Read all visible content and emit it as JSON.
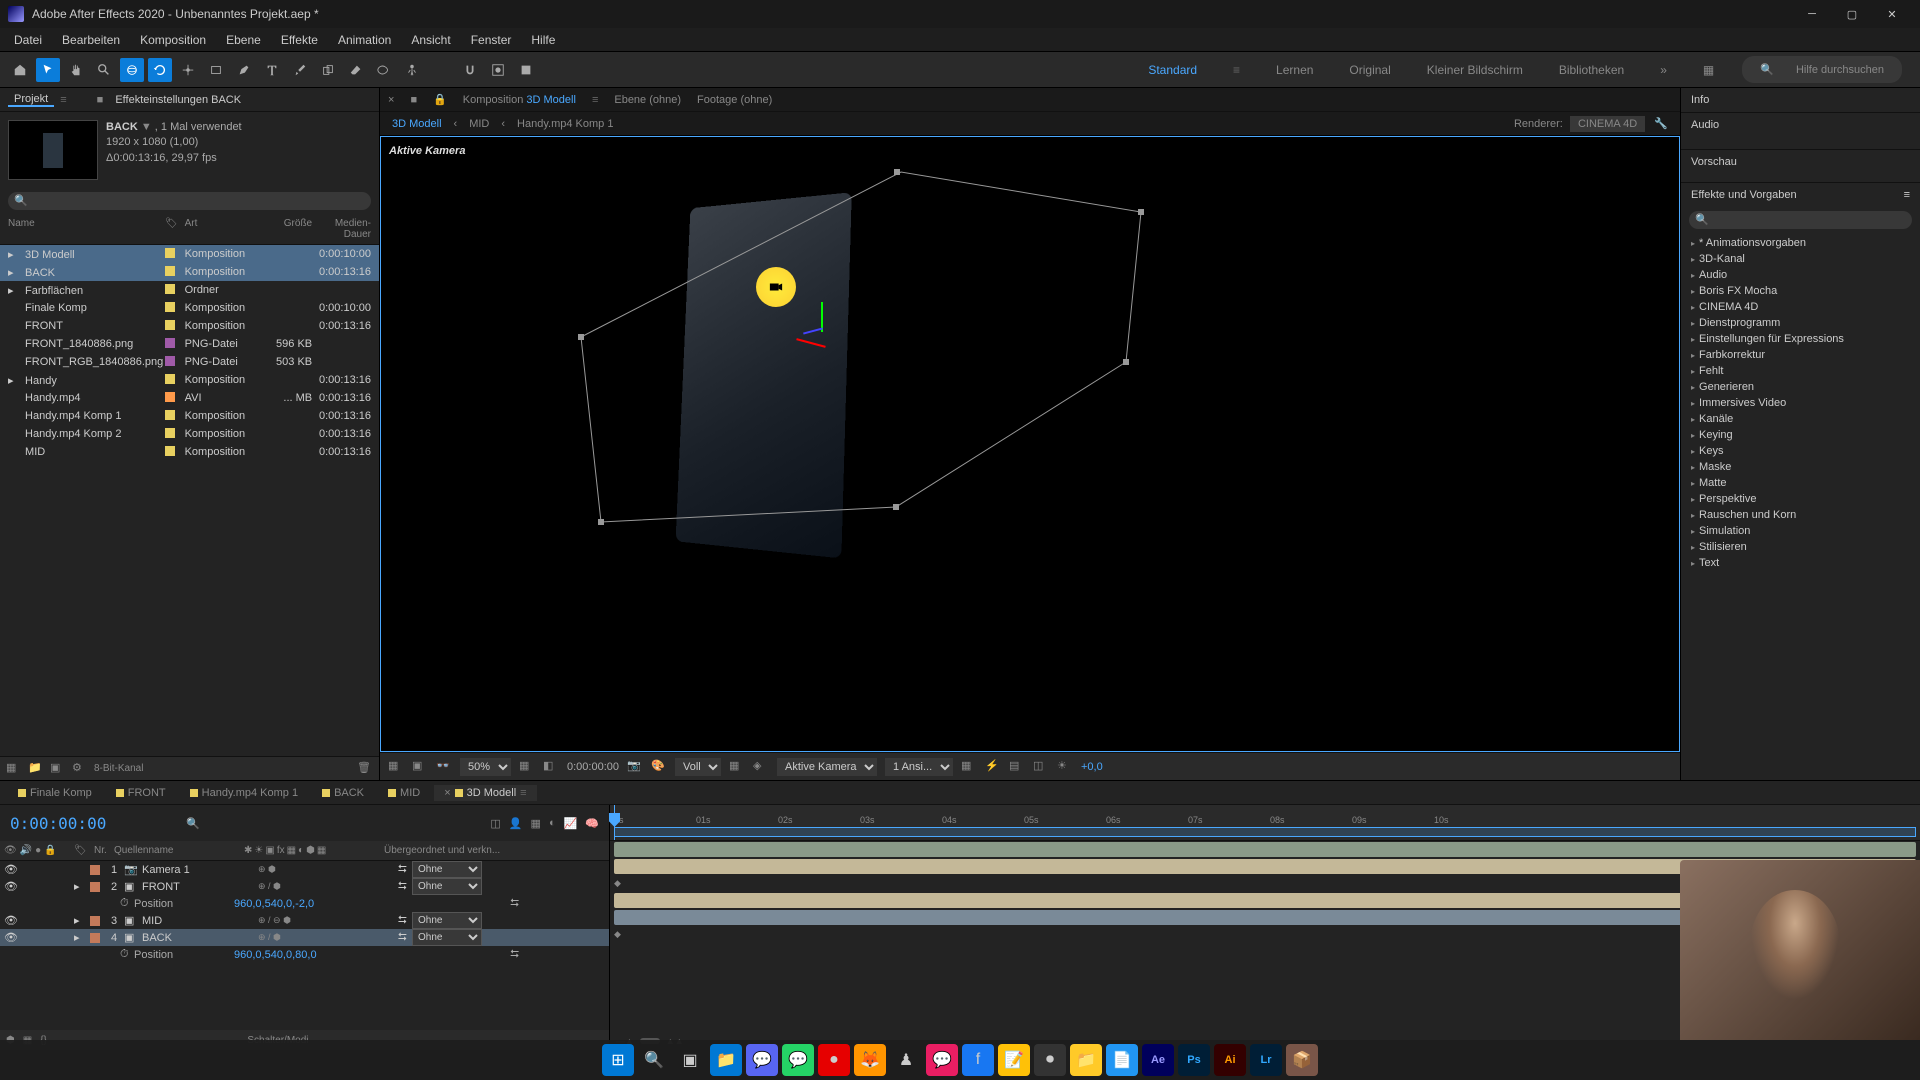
{
  "titlebar": {
    "title": "Adobe After Effects 2020 - Unbenanntes Projekt.aep *"
  },
  "menu": [
    "Datei",
    "Bearbeiten",
    "Komposition",
    "Ebene",
    "Effekte",
    "Animation",
    "Ansicht",
    "Fenster",
    "Hilfe"
  ],
  "workspaces": {
    "items": [
      "Standard",
      "Lernen",
      "Original",
      "Kleiner Bildschirm",
      "Bibliotheken"
    ],
    "active": "Standard"
  },
  "help_search_placeholder": "Hilfe durchsuchen",
  "project": {
    "tab1": "Projekt",
    "tab2": "Effekteinstellungen BACK",
    "selected_name": "BACK",
    "usage": "1 Mal verwendet",
    "resolution": "1920 x 1080 (1,00)",
    "duration": "Δ0:00:13:16, 29,97 fps",
    "columns": {
      "name": "Name",
      "art": "Art",
      "size": "Größe",
      "dur": "Medien-Dauer"
    },
    "items": [
      {
        "name": "3D Modell",
        "icon": "▸",
        "color": "#e8d060",
        "art": "Komposition",
        "size": "",
        "dur": "0:00:10:00",
        "selected": true
      },
      {
        "name": "BACK",
        "icon": "▸",
        "color": "#e8d060",
        "art": "Komposition",
        "size": "",
        "dur": "0:00:13:16",
        "selected": true
      },
      {
        "name": "Farbflächen",
        "icon": "▸",
        "color": "#e8d060",
        "art": "Ordner",
        "size": "",
        "dur": ""
      },
      {
        "name": "Finale Komp",
        "icon": "",
        "color": "#e8d060",
        "art": "Komposition",
        "size": "",
        "dur": "0:00:10:00"
      },
      {
        "name": "FRONT",
        "icon": "",
        "color": "#e8d060",
        "art": "Komposition",
        "size": "",
        "dur": "0:00:13:16"
      },
      {
        "name": "FRONT_1840886.png",
        "icon": "",
        "color": "#a05aa8",
        "art": "PNG-Datei",
        "size": "596 KB",
        "dur": ""
      },
      {
        "name": "FRONT_RGB_1840886.png",
        "icon": "",
        "color": "#a05aa8",
        "art": "PNG-Datei",
        "size": "503 KB",
        "dur": ""
      },
      {
        "name": "Handy",
        "icon": "▸",
        "color": "#e8d060",
        "art": "Komposition",
        "size": "",
        "dur": "0:00:13:16"
      },
      {
        "name": "Handy.mp4",
        "icon": "",
        "color": "#ff9a4a",
        "art": "AVI",
        "size": "... MB",
        "dur": "0:00:13:16"
      },
      {
        "name": "Handy.mp4 Komp 1",
        "icon": "",
        "color": "#e8d060",
        "art": "Komposition",
        "size": "",
        "dur": "0:00:13:16"
      },
      {
        "name": "Handy.mp4 Komp 2",
        "icon": "",
        "color": "#e8d060",
        "art": "Komposition",
        "size": "",
        "dur": "0:00:13:16"
      },
      {
        "name": "MID",
        "icon": "",
        "color": "#e8d060",
        "art": "Komposition",
        "size": "",
        "dur": "0:00:13:16"
      }
    ],
    "footer_depth": "8-Bit-Kanal"
  },
  "comp": {
    "tabs": {
      "komp": "Komposition",
      "komp_name": "3D Modell",
      "ebene": "Ebene (ohne)",
      "footage": "Footage (ohne)"
    },
    "breadcrumb": [
      "3D Modell",
      "MID",
      "Handy.mp4 Komp 1"
    ],
    "renderer_label": "Renderer:",
    "renderer_value": "CINEMA 4D",
    "camera_label": "Aktive Kamera",
    "footer": {
      "zoom": "50%",
      "time": "0:00:00:00",
      "res": "Voll",
      "camera": "Aktive Kamera",
      "views": "1 Ansi...",
      "exposure": "+0,0"
    }
  },
  "right": {
    "info": "Info",
    "audio": "Audio",
    "vorschau": "Vorschau",
    "effects_title": "Effekte und Vorgaben",
    "categories": [
      "* Animationsvorgaben",
      "3D-Kanal",
      "Audio",
      "Boris FX Mocha",
      "CINEMA 4D",
      "Dienstprogramm",
      "Einstellungen für Expressions",
      "Farbkorrektur",
      "Fehlt",
      "Generieren",
      "Immersives Video",
      "Kanäle",
      "Keying",
      "Keys",
      "Maske",
      "Matte",
      "Perspektive",
      "Rauschen und Korn",
      "Simulation",
      "Stilisieren",
      "Text"
    ]
  },
  "timeline": {
    "tabs": [
      {
        "label": "Finale Komp",
        "color": "#e8d060"
      },
      {
        "label": "FRONT",
        "color": "#e8d060"
      },
      {
        "label": "Handy.mp4 Komp 1",
        "color": "#e8d060"
      },
      {
        "label": "BACK",
        "color": "#e8d060"
      },
      {
        "label": "MID",
        "color": "#e8d060"
      },
      {
        "label": "3D Modell",
        "color": "#e8d060",
        "active": true
      }
    ],
    "timecode": "0:00:00:00",
    "header": {
      "nr": "Nr.",
      "quelle": "Quellenname",
      "parent": "Übergeordnet und verkn..."
    },
    "parent_none": "Ohne",
    "ticks": [
      "0s",
      "01s",
      "02s",
      "03s",
      "04s",
      "05s",
      "06s",
      "07s",
      "08s",
      "09s",
      "10s"
    ],
    "layers": [
      {
        "num": "1",
        "name": "Kamera 1",
        "color": "#c47a5a",
        "parent": "Ohne"
      },
      {
        "num": "2",
        "name": "FRONT",
        "color": "#c47a5a",
        "parent": "Ohne",
        "prop": "Position",
        "pval": "960,0,540,0,-2,0"
      },
      {
        "num": "3",
        "name": "MID",
        "color": "#c47a5a",
        "parent": "Ohne"
      },
      {
        "num": "4",
        "name": "BACK",
        "color": "#c47a5a",
        "parent": "Ohne",
        "selected": true,
        "prop": "Position",
        "pval": "960,0,540,0,80,0"
      }
    ],
    "footer": "Schalter/Modi"
  },
  "taskbar_apps": [
    "Ae",
    "Ps",
    "Ai",
    "Lr"
  ]
}
